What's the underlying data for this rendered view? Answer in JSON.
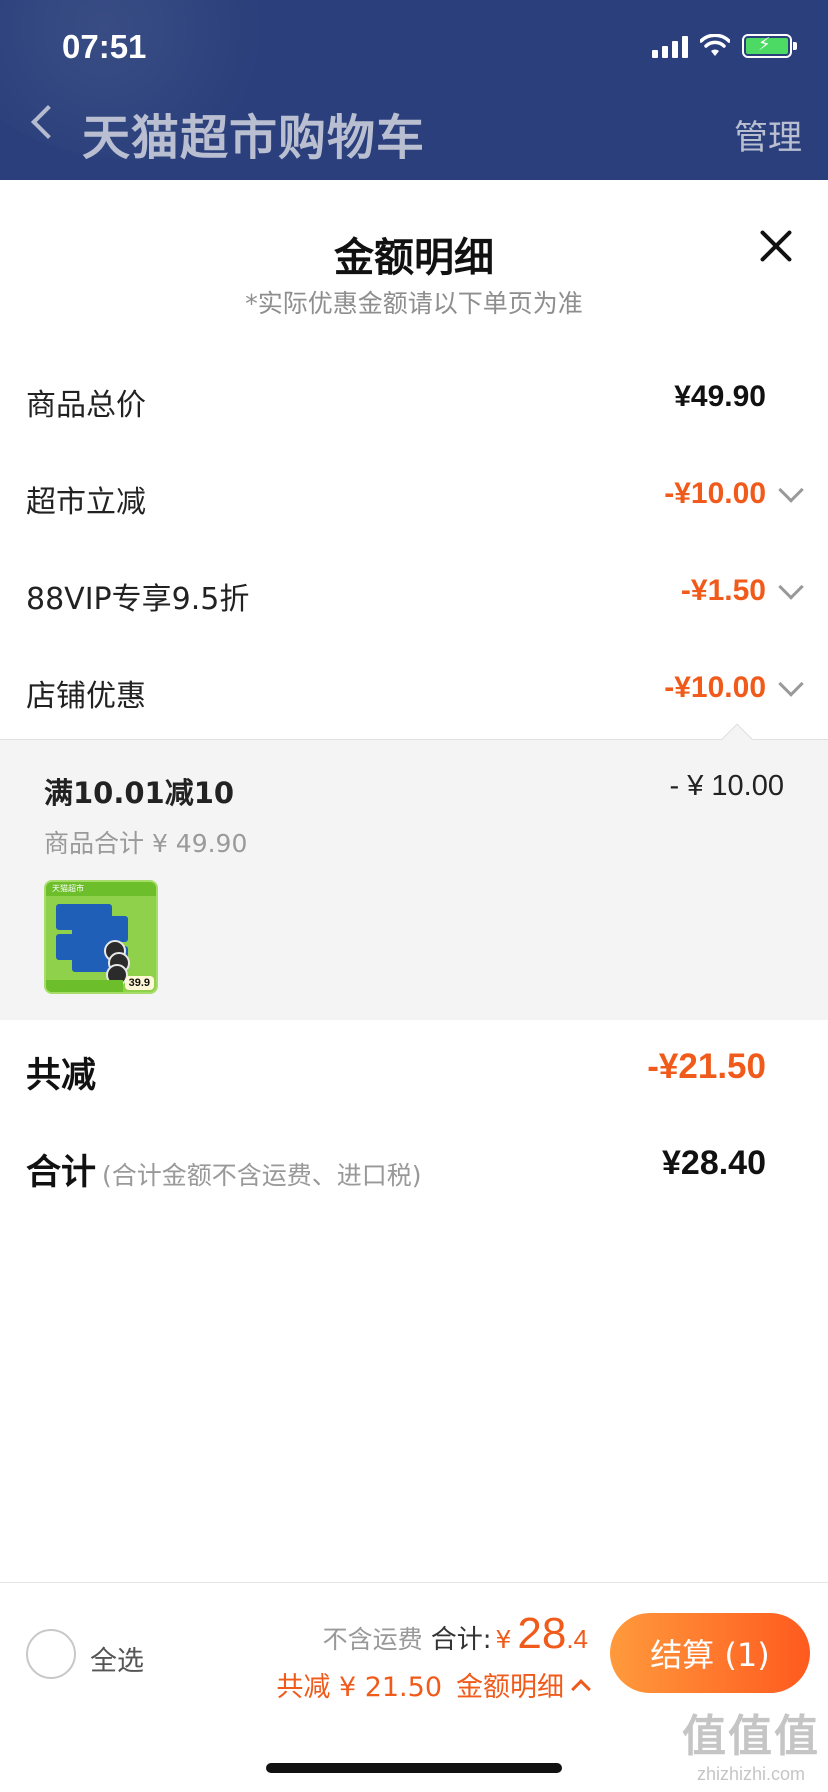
{
  "status_bar": {
    "time": "07:51"
  },
  "header": {
    "title": "天猫超市购物车",
    "manage": "管理"
  },
  "sheet": {
    "title": "金额明细",
    "subtitle": "*实际优惠金额请以下单页为准"
  },
  "rows": [
    {
      "label": "商品总价",
      "value": "¥49.90"
    },
    {
      "label": "超市立减",
      "value": "-¥10.00"
    },
    {
      "label": "88VIP专享9.5折",
      "value": "-¥1.50"
    },
    {
      "label": "店铺优惠",
      "value": "-¥10.00"
    }
  ],
  "shop_discount": {
    "rule": "满10.01减10",
    "rule_value": "- ¥ 10.00",
    "subtotal": "商品合计 ¥ 49.90",
    "product_price_tag": "39.9",
    "product_banner": "天猫超市"
  },
  "total_reduction": {
    "label": "共减",
    "value": "-¥21.50"
  },
  "total": {
    "label": "合计",
    "note": "(合计金额不含运费、进口税)",
    "value": "¥28.40"
  },
  "bottom_bar": {
    "select_all": "全选",
    "no_shipping": "不含运费",
    "total_label": "合计:",
    "currency": "¥",
    "total_int": "28",
    "total_dec": ".4",
    "reduction": "共减 ¥ 21.50",
    "detail_link": "金额明细",
    "checkout": "结算 (1)"
  },
  "watermark": {
    "big": "值值值",
    "small": "zhizhizhi.com"
  },
  "colors": {
    "header": "#2a3f7b",
    "accent": "#f05a1a",
    "checkout_gradient": [
      "#ff9a3c",
      "#ff5a1f"
    ]
  }
}
